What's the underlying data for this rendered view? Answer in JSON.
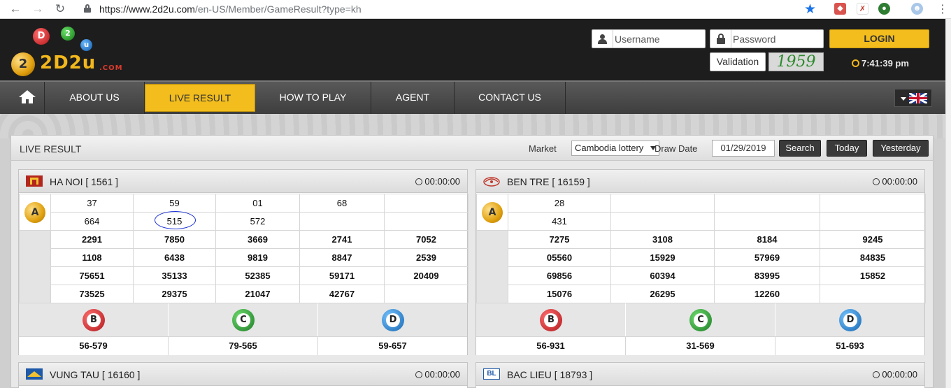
{
  "browser": {
    "url_host": "https://www.2d2u.com",
    "url_path": "/en-US/Member/GameResult?type=kh"
  },
  "header": {
    "logo_balls": [
      "D",
      "2",
      "u",
      "2"
    ],
    "logo_text": "2D2u",
    "logo_com": ".COM",
    "username_placeholder": "Username",
    "password_placeholder": "Password",
    "login_label": "LOGIN",
    "validation_label": "Validation",
    "captcha": "1959",
    "clock": "7:41:39 pm"
  },
  "nav": {
    "items": [
      "ABOUT US",
      "LIVE RESULT",
      "HOW TO PLAY",
      "AGENT",
      "CONTACT US"
    ],
    "active": "LIVE RESULT"
  },
  "panel": {
    "title": "LIVE RESULT",
    "market_label": "Market",
    "market_value": "Cambodia lottery",
    "draw_date_label": "Draw Date",
    "draw_date": "01/29/2019",
    "buttons": [
      "Search",
      "Today",
      "Yesterday"
    ]
  },
  "cards": [
    {
      "title": "HA NOI [ 1561 ]",
      "time": "00:00:00",
      "label_a": "A",
      "rows": [
        [
          "37",
          "59",
          "01",
          "68",
          ""
        ],
        [
          "664",
          "515",
          "572",
          "",
          ""
        ],
        [
          "2291",
          "7850",
          "3669",
          "2741",
          "7052"
        ],
        [
          "1108",
          "6438",
          "9819",
          "8847",
          "2539"
        ],
        [
          "75651",
          "35133",
          "52385",
          "59171",
          "20409"
        ],
        [
          "73525",
          "29375",
          "21047",
          "42767",
          ""
        ]
      ],
      "balls": [
        "B",
        "C",
        "D"
      ],
      "results": [
        "56-579",
        "79-565",
        "59-657"
      ]
    },
    {
      "title": "BEN TRE [ 16159 ]",
      "time": "00:00:00",
      "label_a": "A",
      "rows": [
        [
          "28",
          "",
          "",
          ""
        ],
        [
          "431",
          "",
          "",
          ""
        ],
        [
          "7275",
          "3108",
          "8184",
          "9245"
        ],
        [
          "05560",
          "15929",
          "57969",
          "84835"
        ],
        [
          "69856",
          "60394",
          "83995",
          "15852"
        ],
        [
          "15076",
          "26295",
          "12260",
          ""
        ]
      ],
      "balls": [
        "B",
        "C",
        "D"
      ],
      "results": [
        "56-931",
        "31-569",
        "51-693"
      ]
    },
    {
      "title": "VUNG TAU [ 16160 ]",
      "time": "00:00:00"
    },
    {
      "title": "BAC LIEU [ 18793 ]",
      "time": "00:00:00",
      "badge": "BL"
    }
  ],
  "colors": {
    "accent_yellow": "#f2bd1d",
    "ball_b": "#c8282a",
    "ball_c": "#2f9a3a",
    "ball_d": "#2a8fd6"
  }
}
